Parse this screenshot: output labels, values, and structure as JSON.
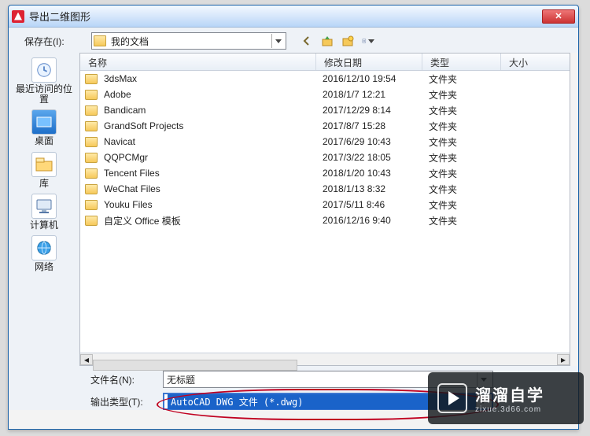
{
  "window": {
    "title": "导出二维图形"
  },
  "toprow": {
    "save_in_label": "保存在(I):",
    "current_folder": "我的文档"
  },
  "sidebar": {
    "places": [
      {
        "label": "最近访问的位置"
      },
      {
        "label": "桌面"
      },
      {
        "label": "库"
      },
      {
        "label": "计算机"
      },
      {
        "label": "网络"
      }
    ]
  },
  "columns": {
    "name": "名称",
    "date": "修改日期",
    "type": "类型",
    "size": "大小"
  },
  "rows": [
    {
      "name": "3dsMax",
      "date": "2016/12/10 19:54",
      "type": "文件夹"
    },
    {
      "name": "Adobe",
      "date": "2018/1/7 12:21",
      "type": "文件夹"
    },
    {
      "name": "Bandicam",
      "date": "2017/12/29 8:14",
      "type": "文件夹"
    },
    {
      "name": "GrandSoft Projects",
      "date": "2017/8/7 15:28",
      "type": "文件夹"
    },
    {
      "name": "Navicat",
      "date": "2017/6/29 10:43",
      "type": "文件夹"
    },
    {
      "name": "QQPCMgr",
      "date": "2017/3/22 18:05",
      "type": "文件夹"
    },
    {
      "name": "Tencent Files",
      "date": "2018/1/20 10:43",
      "type": "文件夹"
    },
    {
      "name": "WeChat Files",
      "date": "2018/1/13 8:32",
      "type": "文件夹"
    },
    {
      "name": "Youku Files",
      "date": "2017/5/11 8:46",
      "type": "文件夹"
    },
    {
      "name": "自定义 Office 模板",
      "date": "2016/12/16 9:40",
      "type": "文件夹"
    }
  ],
  "bottom": {
    "filename_label": "文件名(N):",
    "filename_value": "无标题",
    "filetype_label": "输出类型(T):",
    "filetype_value": "AutoCAD DWG 文件 (*.dwg)"
  },
  "watermark": {
    "big": "溜溜自学",
    "small": "zixue.3d66.com"
  }
}
